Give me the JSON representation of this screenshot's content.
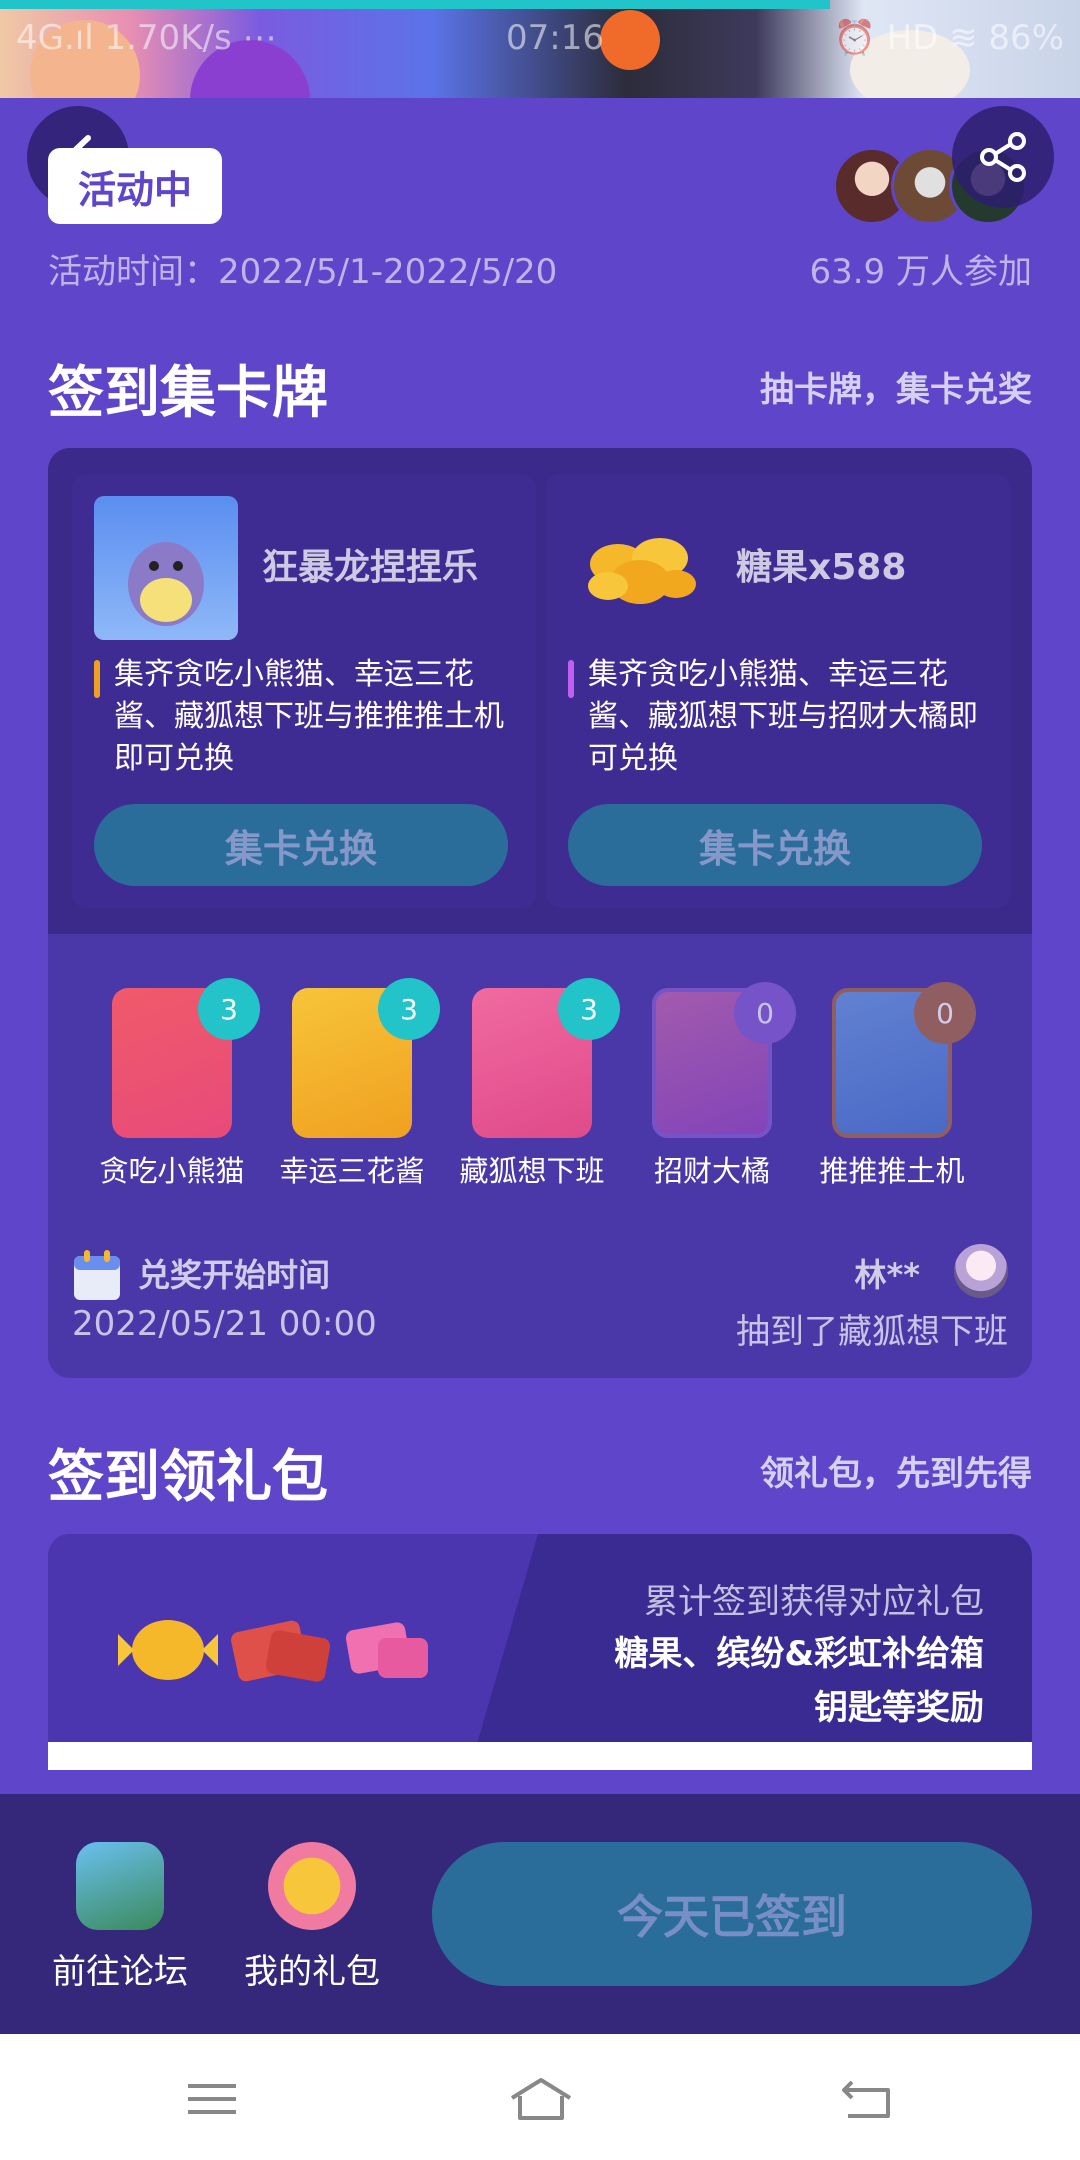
{
  "status_bar": {
    "left": "4G.ıl 1.70K/s ⋯",
    "time": "07:16",
    "right": "⏰ HD ≋ 86%"
  },
  "header": {
    "status_badge": "活动中",
    "event_time": "活动时间：2022/5/1-2022/5/20",
    "participants": "63.9 万人参加"
  },
  "section_cards": {
    "title": "签到集卡牌",
    "subtitle": "抽卡牌，集卡兑奖",
    "rewards": [
      {
        "name": "狂暴龙捏捏乐",
        "desc": "集齐贪吃小熊猫、幸运三花酱、藏狐想下班与推推推土机即可兑换",
        "button": "集卡兑换",
        "bar_color": "#f0a020"
      },
      {
        "name": "糖果x588",
        "desc": "集齐贪吃小熊猫、幸运三花酱、藏狐想下班与招财大橘即可兑换",
        "button": "集卡兑换",
        "bar_color": "#c060f0"
      }
    ],
    "collectibles": [
      {
        "label": "贪吃小熊猫",
        "count": "3"
      },
      {
        "label": "幸运三花酱",
        "count": "3"
      },
      {
        "label": "藏狐想下班",
        "count": "3"
      },
      {
        "label": "招财大橘",
        "count": "0"
      },
      {
        "label": "推推推土机",
        "count": "0"
      }
    ],
    "redeem_title": "兑奖开始时间",
    "redeem_time": "2022/05/21 00:00",
    "winner_name": "林**",
    "winner_msg": "抽到了藏狐想下班"
  },
  "section_gifts": {
    "title": "签到领礼包",
    "subtitle": "领礼包，先到先得",
    "line1": "累计签到获得对应礼包",
    "line2": "糖果、缤纷&彩虹补给箱",
    "line3": "钥匙等奖励"
  },
  "bottom_bar": {
    "forum": "前往论坛",
    "my_gifts": "我的礼包",
    "signed_button": "今天已签到"
  },
  "colors": {
    "background": "#5e45c9",
    "button_teal": "#2b6d9a",
    "count_teal": "#22c3c9",
    "count_purple": "#8a5fd8",
    "count_brown": "#a86a4a"
  }
}
